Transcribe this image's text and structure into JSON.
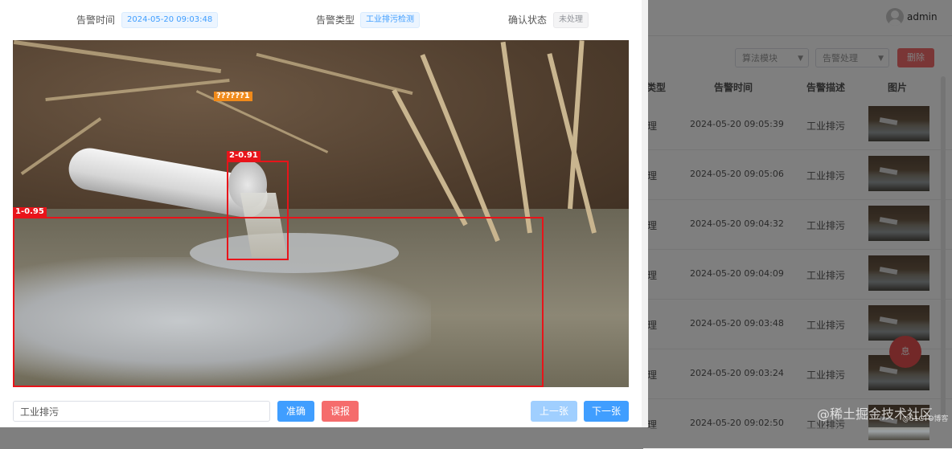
{
  "user": {
    "name": "admin"
  },
  "toolbar": {
    "algorithm_placeholder": "算法模块",
    "handling_placeholder": "告警处理",
    "action_label": "删除"
  },
  "table": {
    "headers": {
      "type": "类型",
      "time": "告警时间",
      "desc": "告警描述",
      "image": "图片"
    },
    "rows": [
      {
        "type": "理",
        "time": "2024-05-20 09:05:39",
        "desc": "工业排污"
      },
      {
        "type": "理",
        "time": "2024-05-20 09:05:06",
        "desc": "工业排污"
      },
      {
        "type": "理",
        "time": "2024-05-20 09:04:32",
        "desc": "工业排污"
      },
      {
        "type": "理",
        "time": "2024-05-20 09:04:09",
        "desc": "工业排污"
      },
      {
        "type": "理",
        "time": "2024-05-20 09:03:48",
        "desc": "工业排污"
      },
      {
        "type": "理",
        "time": "2024-05-20 09:03:24",
        "desc": "工业排污"
      },
      {
        "type": "理",
        "time": "2024-05-20 09:02:50",
        "desc": "工业排污"
      }
    ]
  },
  "fab": {
    "label": "息"
  },
  "watermark": {
    "text": "@稀土掘金技术社区",
    "small": "@51CTO博客"
  },
  "modal": {
    "alarm_time_label": "告警时间",
    "alarm_time_value": "2024-05-20 09:03:48",
    "alarm_type_label": "告警类型",
    "alarm_type_value": "工业排污检测",
    "confirm_status_label": "确认状态",
    "confirm_status_value": "未处理",
    "detections": [
      {
        "label": "1-0.95"
      },
      {
        "label": "2-0.91"
      },
      {
        "label": "??????1"
      }
    ],
    "description_value": "工业排污",
    "confirm_button": "准确",
    "false_alarm_button": "误报",
    "prev_button": "上一张",
    "next_button": "下一张"
  },
  "colors": {
    "primary": "#409eff",
    "danger": "#f56c6c",
    "detection": "#e8141a"
  }
}
